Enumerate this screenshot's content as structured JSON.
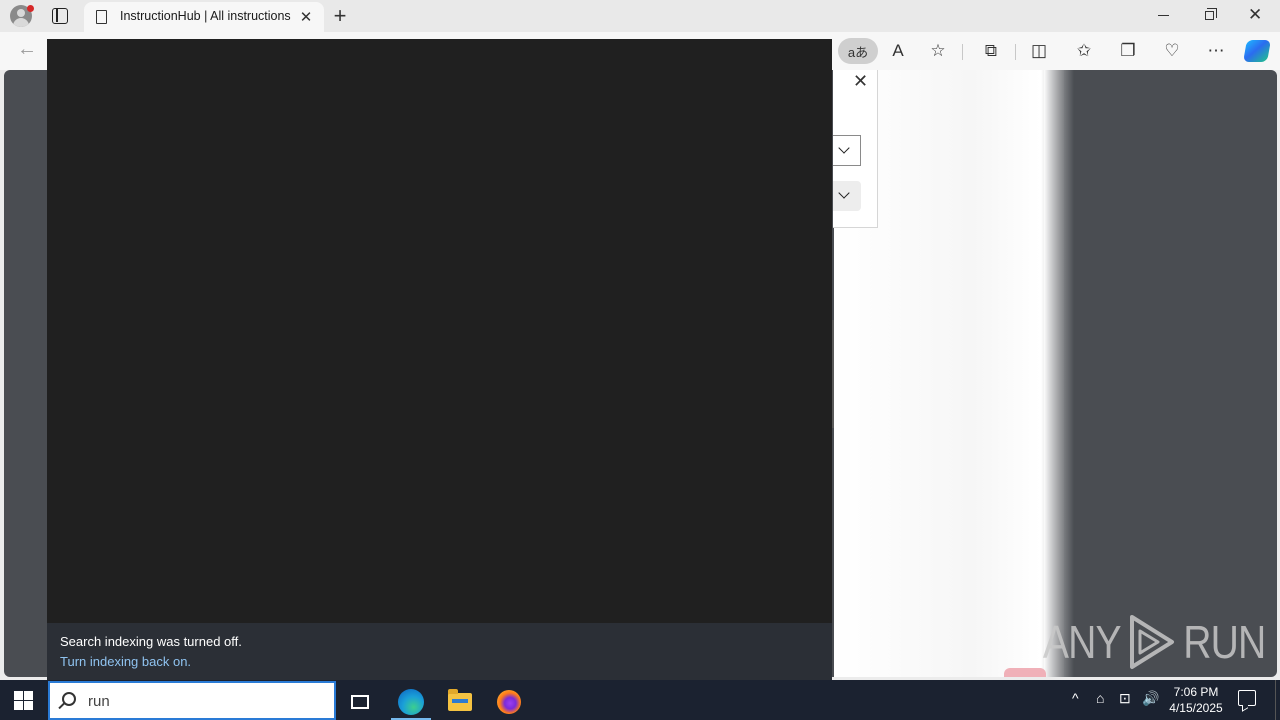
{
  "browser": {
    "tab_title": "InstructionHub | All instructions",
    "tab_close_glyph": "✕",
    "new_tab_glyph": "+",
    "translate_label": "aあ"
  },
  "toolbar": {
    "read_aloud_glyph": "A",
    "favorite_glyph": "☆",
    "extensions_glyph": "⧉",
    "split_glyph": "◫",
    "favorites_glyph": "✩",
    "collections_glyph": "❐",
    "performance_glyph": "♡",
    "more_glyph": "⋯"
  },
  "page_panel": {
    "close_glyph": "✕"
  },
  "search_panel": {
    "footer_message": "Search indexing was turned off.",
    "footer_link": "Turn indexing back on."
  },
  "taskbar": {
    "search_value": "run",
    "clock_time": "7:06 PM",
    "clock_date": "4/15/2025",
    "tray_chevron": "^",
    "tray_icons": [
      "⌂",
      "⊡",
      "🔊"
    ]
  },
  "watermark": {
    "left": "ANY",
    "right": "RUN"
  },
  "colors": {
    "accent": "#2a7bd6",
    "search_bg": "#202020",
    "footer_bg": "#2b2f36",
    "link": "#8fc3f0",
    "taskbar": "#1b2230"
  }
}
